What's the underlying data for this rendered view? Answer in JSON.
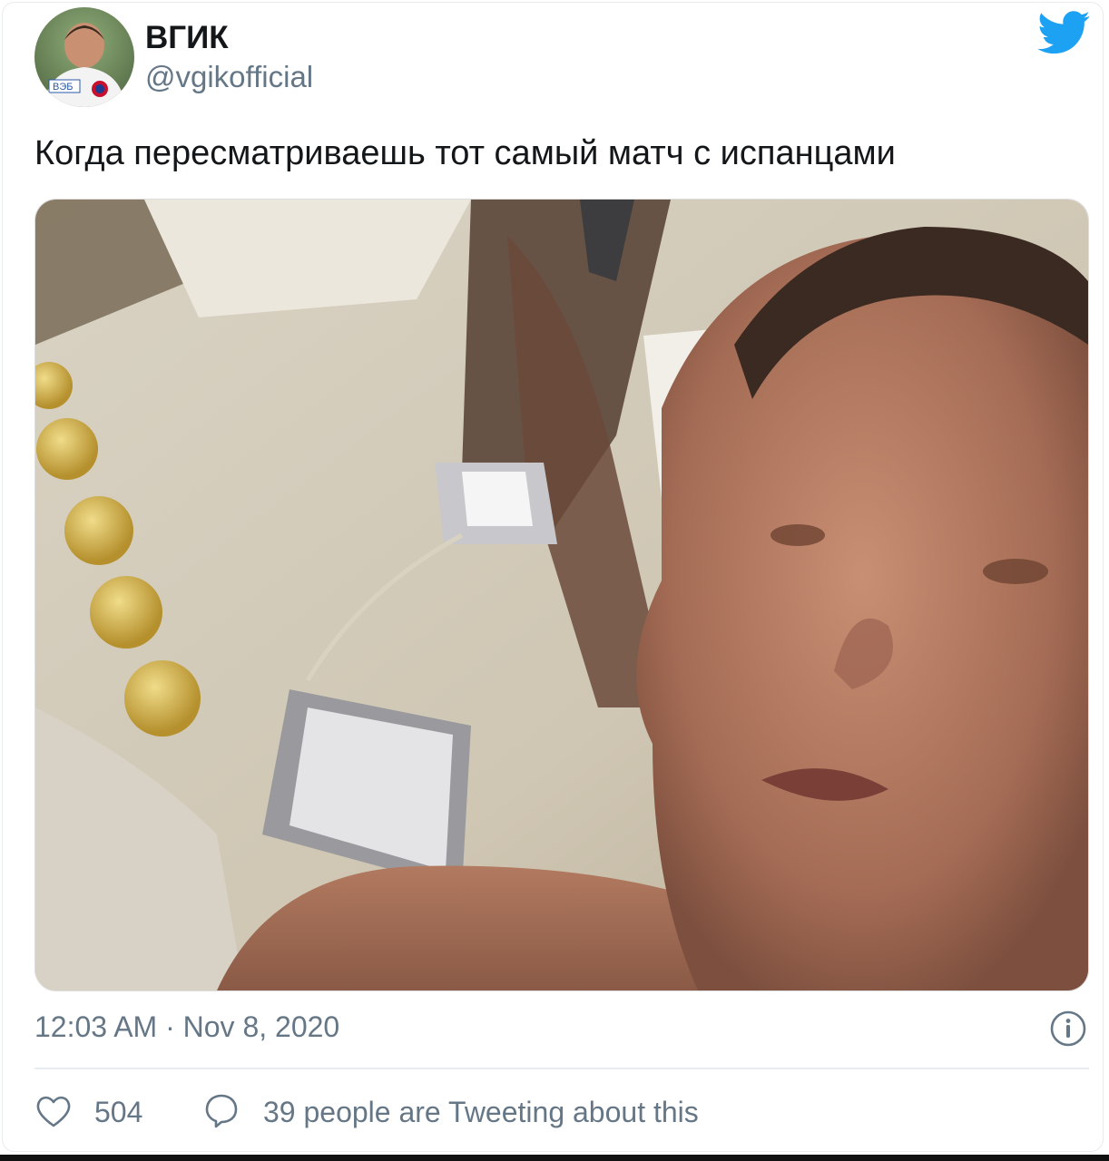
{
  "author": {
    "name": "ВГИК",
    "handle": "@vgikofficial",
    "avatar_icon": "avatar-photo",
    "avatar_jersey_text": "ВЭБ"
  },
  "platform_icon": "twitter-bird-icon",
  "tweet": {
    "text": "Когда пересматриваешь тот самый матч с испанцами"
  },
  "media": {
    "kind": "video-still"
  },
  "meta": {
    "timestamp": "12:03 AM · Nov 8, 2020",
    "info_icon": "info-icon"
  },
  "actions": {
    "likes": "504",
    "conversation": "39 people are Tweeting about this"
  },
  "colors": {
    "twitter_blue": "#1da1f2",
    "text": "#14171a",
    "muted": "#657786",
    "divider": "#e6ecf0"
  }
}
